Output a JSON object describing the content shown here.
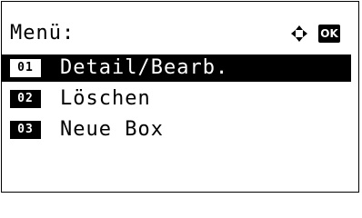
{
  "header": {
    "title": "Menü:",
    "nav_icon": "four-way-arrow-icon",
    "ok_label": "OK"
  },
  "colors": {
    "foreground": "#000000",
    "background": "#ffffff",
    "selection": "#000000"
  },
  "menu": {
    "items": [
      {
        "number": "01",
        "label": "Detail/Bearb.",
        "selected": true
      },
      {
        "number": "02",
        "label": "Löschen",
        "selected": false
      },
      {
        "number": "03",
        "label": "Neue Box",
        "selected": false
      }
    ]
  }
}
